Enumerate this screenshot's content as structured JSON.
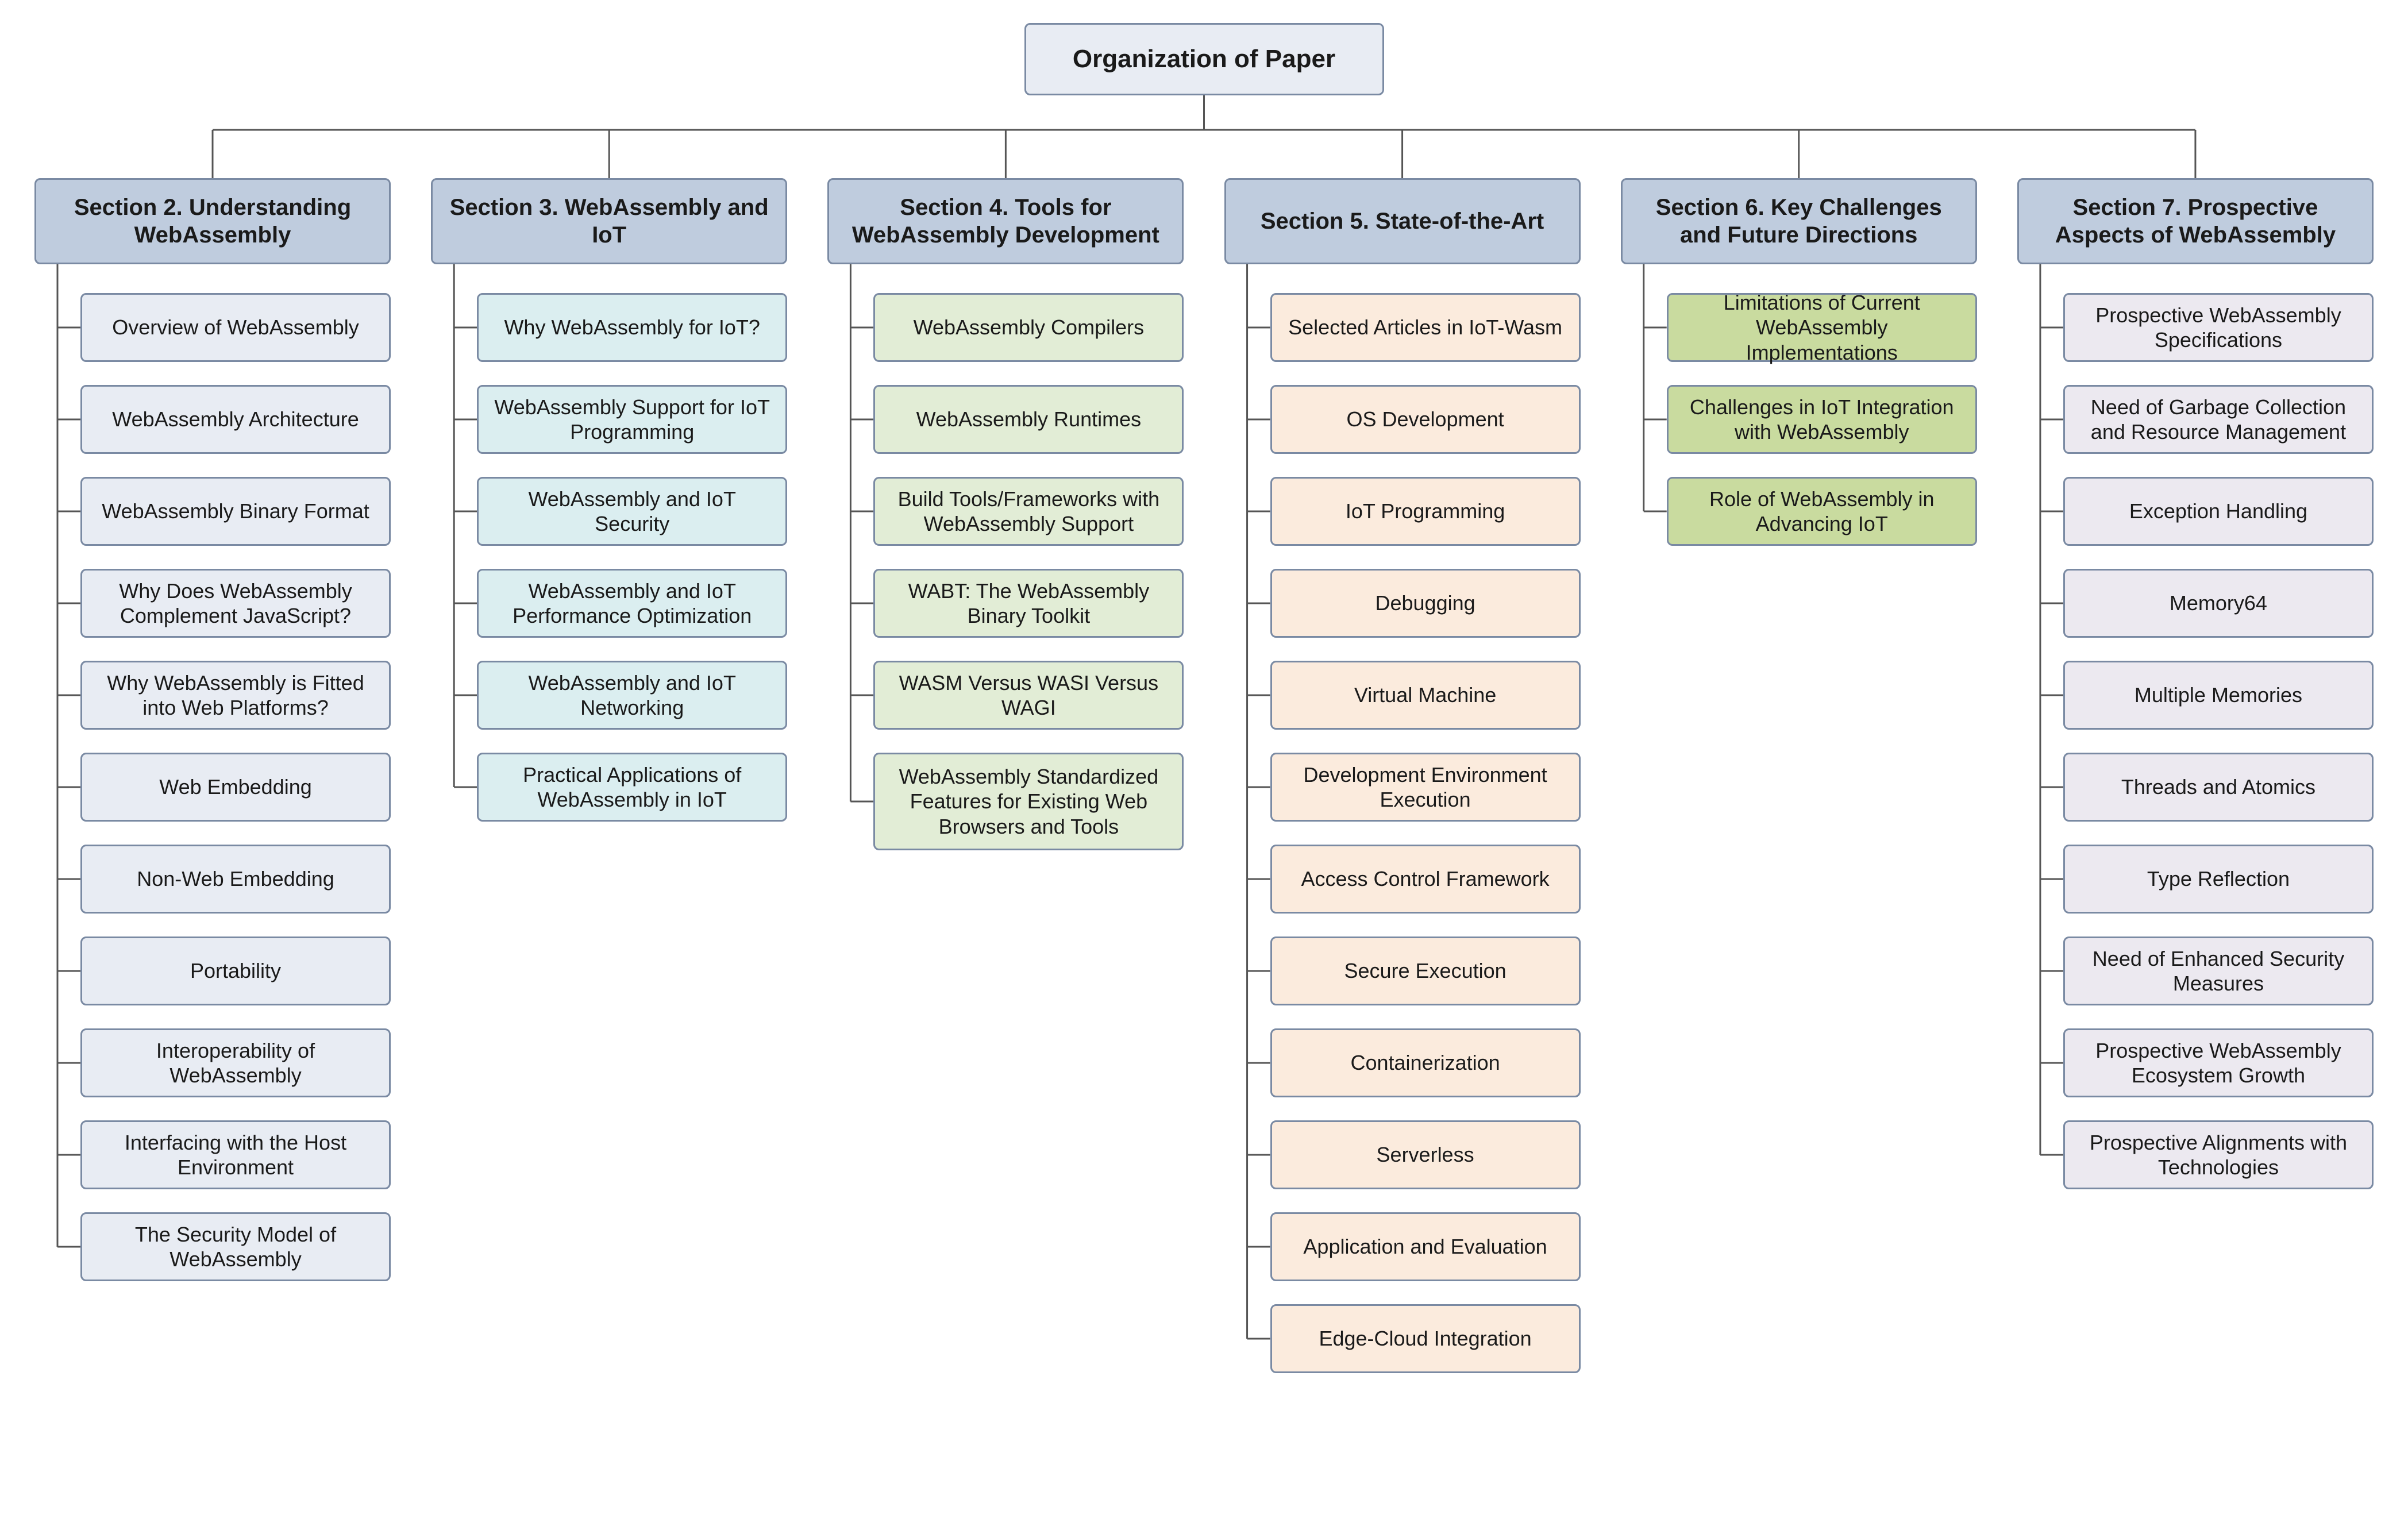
{
  "root": {
    "title": "Organization of Paper"
  },
  "sections": [
    {
      "title": "Section 2. Understanding WebAssembly",
      "headClass": "c-blue-head",
      "bodyClass": "c-blue-body",
      "items": [
        "Overview of WebAssembly",
        "WebAssembly Architecture",
        "WebAssembly Binary Format",
        "Why Does WebAssembly Complement JavaScript?",
        "Why WebAssembly is Fitted into Web Platforms?",
        "Web Embedding",
        "Non-Web Embedding",
        "Portability",
        "Interoperability of WebAssembly",
        "Interfacing with the Host Environment",
        "The Security Model of WebAssembly"
      ]
    },
    {
      "title": "Section 3. WebAssembly and IoT",
      "headClass": "c-blue-head",
      "bodyClass": "c-teal-body",
      "items": [
        "Why WebAssembly for IoT?",
        "WebAssembly Support for IoT Programming",
        "WebAssembly and IoT Security",
        "WebAssembly and IoT Performance Optimization",
        "WebAssembly and IoT Networking",
        "Practical Applications of WebAssembly in IoT"
      ]
    },
    {
      "title": "Section 4. Tools for WebAssembly Development",
      "headClass": "c-blue-head",
      "bodyClass": "c-green-body",
      "items": [
        "WebAssembly Compilers",
        "WebAssembly Runtimes",
        "Build Tools/Frameworks with WebAssembly Support",
        "WABT: The WebAssembly Binary Toolkit",
        "WASM Versus WASI Versus WAGI",
        "WebAssembly Standardized Features for Existing Web Browsers and Tools"
      ]
    },
    {
      "title": "Section 5. State-of-the-Art",
      "headClass": "c-blue-head",
      "bodyClass": "c-peach-body",
      "items": [
        "Selected Articles in IoT-Wasm",
        "OS Development",
        "IoT Programming",
        "Debugging",
        "Virtual Machine",
        "Development Environment Execution",
        "Access Control Framework",
        "Secure Execution",
        "Containerization",
        "Serverless",
        "Application and Evaluation",
        "Edge-Cloud Integration"
      ]
    },
    {
      "title": "Section 6. Key Challenges and Future Directions",
      "headClass": "c-blue-head",
      "bodyClass": "c-olive-body",
      "items": [
        "Limitations of Current WebAssembly Implementations",
        "Challenges in IoT Integration with WebAssembly",
        "Role of WebAssembly in Advancing IoT"
      ]
    },
    {
      "title": "Section 7. Prospective Aspects of WebAssembly",
      "headClass": "c-blue-head",
      "bodyClass": "c-lav-body",
      "items": [
        "Prospective WebAssembly Specifications",
        "Need of Garbage Collection and Resource Management",
        "Exception Handling",
        "Memory64",
        "Multiple Memories",
        "Threads and Atomics",
        "Type Reflection",
        "Need of Enhanced Security Measures",
        "Prospective WebAssembly Ecosystem Growth",
        "Prospective Alignments with Technologies"
      ]
    }
  ]
}
